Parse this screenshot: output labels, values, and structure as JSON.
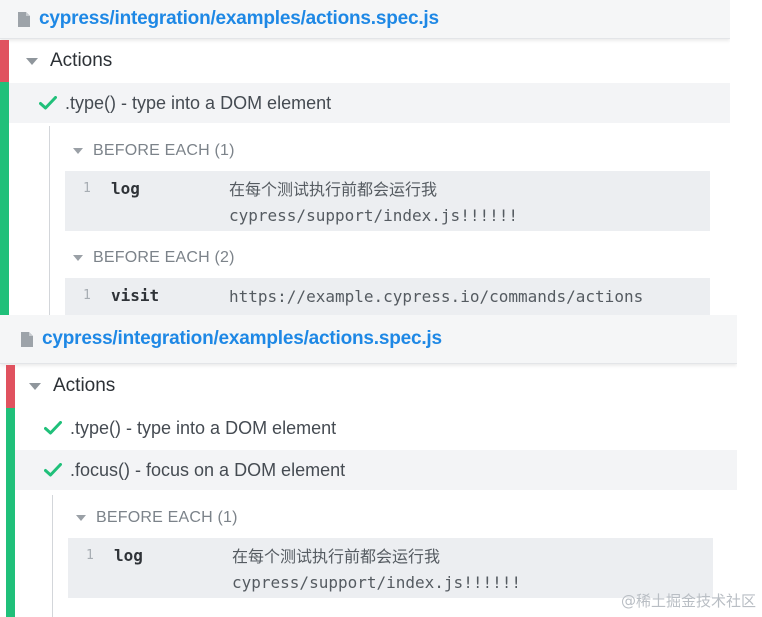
{
  "panels": [
    {
      "file_path": "cypress/integration/examples/actions.spec.js",
      "suite_title": "Actions",
      "tests": [
        ".type() - type into a DOM element"
      ],
      "hooks": [
        {
          "title": "BEFORE EACH (1)",
          "commands": [
            {
              "num": "1",
              "name": "log",
              "message": "在每个测试执行前都会运行我\ncypress/support/index.js!!!!!!"
            }
          ]
        },
        {
          "title": "BEFORE EACH (2)",
          "commands": [
            {
              "num": "1",
              "name": "visit",
              "message": "https://example.cypress.io/commands/actions"
            }
          ]
        }
      ]
    },
    {
      "file_path": "cypress/integration/examples/actions.spec.js",
      "suite_title": "Actions",
      "tests": [
        ".type() - type into a DOM element",
        ".focus() - focus on a DOM element"
      ],
      "hooks": [
        {
          "title": "BEFORE EACH (1)",
          "commands": [
            {
              "num": "1",
              "name": "log",
              "message": "在每个测试执行前都会运行我\ncypress/support/index.js!!!!!!"
            }
          ]
        }
      ]
    }
  ],
  "watermark": "@稀土掘金技术社区",
  "colors": {
    "link": "#1e88e5",
    "pass": "#20c07a",
    "fail": "#e0525f"
  },
  "icons": {
    "file": "file-icon",
    "caret": "caret-down-icon",
    "check": "check-icon"
  }
}
